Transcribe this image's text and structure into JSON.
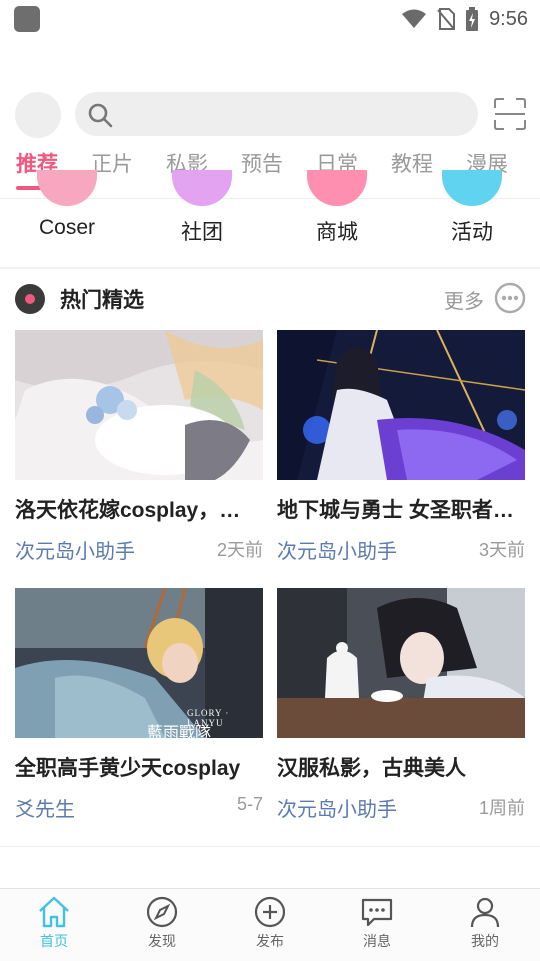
{
  "status_bar": {
    "time": "9:56",
    "icons": [
      "app-icon",
      "wifi-icon",
      "no-sim-icon",
      "battery-charging-icon"
    ]
  },
  "search": {
    "placeholder": ""
  },
  "tabs": [
    {
      "label": "推荐",
      "active": true
    },
    {
      "label": "正片"
    },
    {
      "label": "私影"
    },
    {
      "label": "预告"
    },
    {
      "label": "日常"
    },
    {
      "label": "教程"
    },
    {
      "label": "漫展"
    }
  ],
  "categories": [
    {
      "label": "Coser",
      "color": "#f7a8c0"
    },
    {
      "label": "社团",
      "color": "#e3a3f0"
    },
    {
      "label": "商城",
      "color": "#ff8fb0"
    },
    {
      "label": "活动",
      "color": "#5fd3f0"
    }
  ],
  "section": {
    "title": "热门精选",
    "more": "更多"
  },
  "cards": [
    {
      "title": "洛天依花嫁cosplay，…",
      "author": "次元岛小助手",
      "time": "2天前"
    },
    {
      "title": "地下城与勇士 女圣职者…",
      "author": "次元岛小助手",
      "time": "3天前"
    },
    {
      "title": "全职高手黄少天cosplay",
      "author": "爻先生",
      "time": "5-7",
      "overlay": "GLORY · LANYU",
      "overlay2": "藍雨戰隊"
    },
    {
      "title": "汉服私影，古典美人",
      "author": "次元岛小助手",
      "time": "1周前"
    }
  ],
  "bottom_nav": [
    {
      "label": "首页",
      "icon": "home-icon",
      "active": true
    },
    {
      "label": "发现",
      "icon": "compass-icon"
    },
    {
      "label": "发布",
      "icon": "plus-circle-icon"
    },
    {
      "label": "消息",
      "icon": "message-icon"
    },
    {
      "label": "我的",
      "icon": "user-icon"
    }
  ],
  "colors": {
    "accent": "#f0587f",
    "nav_active": "#3fc1e8",
    "author": "#5b7bb0"
  }
}
